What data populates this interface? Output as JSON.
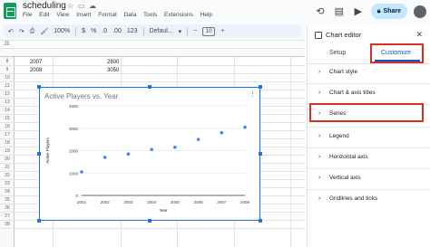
{
  "app": {
    "doc_title": "scheduling",
    "menus": [
      "File",
      "Edit",
      "View",
      "Insert",
      "Format",
      "Data",
      "Tools",
      "Extensions",
      "Help"
    ],
    "share_label": "Share",
    "avatar_initial": "",
    "accent": "#1a73e8",
    "highlight": "#d93025"
  },
  "toolbar": {
    "zoom": "100%",
    "currency": "$",
    "percent": "%",
    "decimal_less": ".0",
    "decimal_more": ".00",
    "number_format": "123",
    "font": "Defaul...",
    "font_size": "10"
  },
  "formula_bar": {
    "cell_ref": "J3"
  },
  "sheet": {
    "rows": [
      {
        "num": "8",
        "a": "2007",
        "b": "2800"
      },
      {
        "num": "9",
        "a": "2008",
        "b": "3050"
      },
      {
        "num": "10"
      },
      {
        "num": "11"
      },
      {
        "num": "12"
      },
      {
        "num": "13"
      },
      {
        "num": "14"
      },
      {
        "num": "15"
      },
      {
        "num": "16"
      },
      {
        "num": "17"
      },
      {
        "num": "18"
      },
      {
        "num": "19"
      },
      {
        "num": "20"
      },
      {
        "num": "21"
      },
      {
        "num": "22"
      },
      {
        "num": "23"
      },
      {
        "num": "24"
      },
      {
        "num": "25"
      },
      {
        "num": "26"
      },
      {
        "num": "27"
      },
      {
        "num": "28"
      }
    ]
  },
  "chart_data": {
    "type": "scatter",
    "title": "Active Players vs. Year",
    "xlabel": "Year",
    "ylabel": "Active Players",
    "x": [
      2001,
      2002,
      2003,
      2004,
      2005,
      2006,
      2007,
      2008
    ],
    "y": [
      1050,
      1700,
      1850,
      2050,
      2150,
      2500,
      2800,
      3050
    ],
    "xlim": [
      2001,
      2008
    ],
    "ylim": [
      0,
      4000
    ],
    "yticks": [
      "0",
      "1000",
      "2000",
      "3000",
      "4000"
    ],
    "xticks": [
      "2001",
      "2002",
      "2003",
      "2004",
      "2005",
      "2006",
      "2007",
      "2008"
    ],
    "point_color": "#4285f4",
    "grid": true
  },
  "panel": {
    "title": "Chart editor",
    "tabs": {
      "setup": "Setup",
      "customize": "Customize"
    },
    "sections": [
      "Chart style",
      "Chart & axis titles",
      "Series",
      "Legend",
      "Horizontal axis",
      "Vertical axis",
      "Gridlines and ticks"
    ]
  }
}
